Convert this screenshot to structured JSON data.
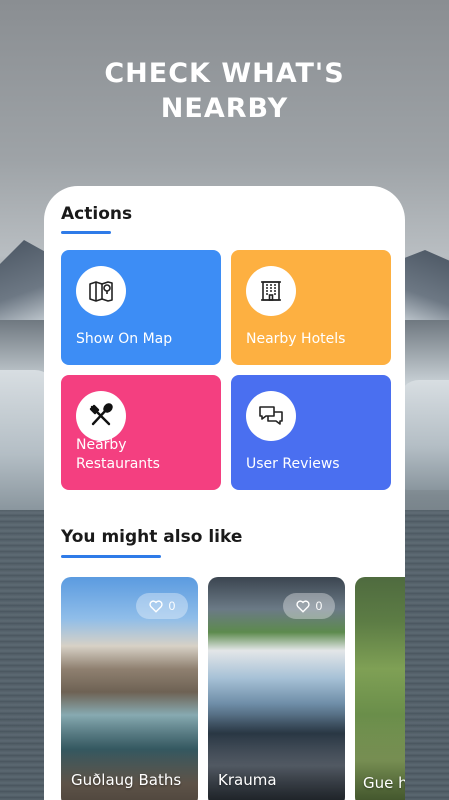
{
  "headline": [
    "CHECK WHAT'S",
    "NEARBY"
  ],
  "actions": {
    "title": "Actions",
    "tiles": [
      {
        "label": "Show On Map",
        "icon": "map-pin-icon",
        "color": "#3d8df5"
      },
      {
        "label": "Nearby Hotels",
        "icon": "hotel-building-icon",
        "color": "#fdb041"
      },
      {
        "label": "Nearby Restaurants",
        "icon": "fork-spoon-icon",
        "color": "#f43f80"
      },
      {
        "label": "User Reviews",
        "icon": "chat-bubbles-icon",
        "color": "#4a6ff0"
      }
    ]
  },
  "suggestions": {
    "title": "You might also like",
    "cards": [
      {
        "name": "Guðlaug Baths",
        "likes": "0"
      },
      {
        "name": "Krauma",
        "likes": "0"
      },
      {
        "name": "Gue hot"
      }
    ]
  },
  "accent": "#2f7be8"
}
